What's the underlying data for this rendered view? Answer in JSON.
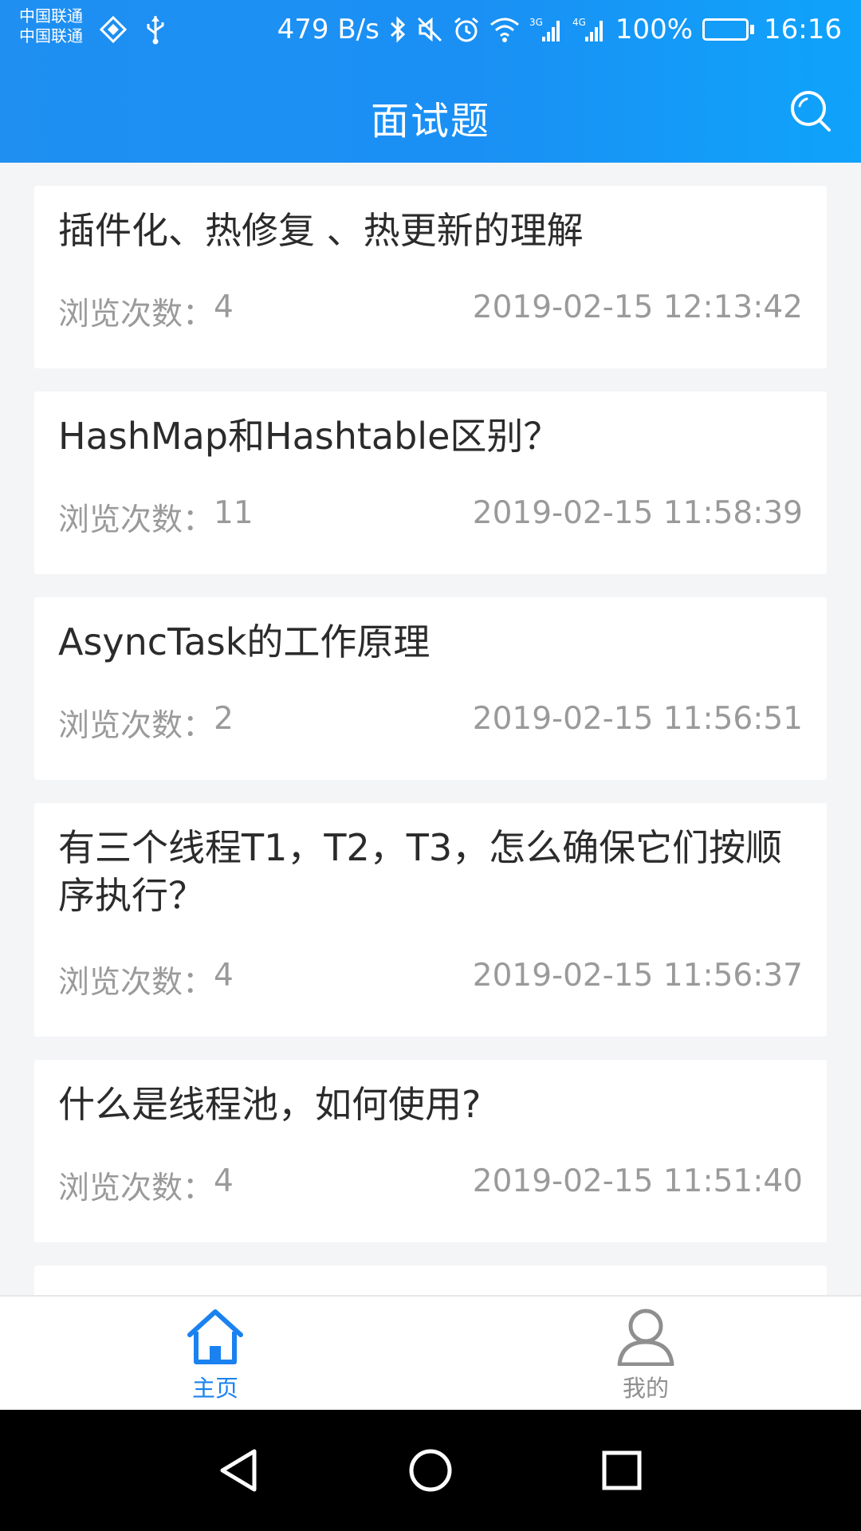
{
  "status_bar": {
    "carrier_1": "中国联通",
    "carrier_2": "中国联通",
    "net_speed": "479 B/s",
    "net_3g": "3G",
    "net_4g": "4G",
    "battery": "100%",
    "time": "16:16"
  },
  "header": {
    "title": "面试题",
    "search_icon": "search-icon"
  },
  "list": {
    "items": [
      {
        "title": "插件化、热修复 、热更新的理解",
        "views_label": "浏览次数：",
        "views": "4",
        "datetime": "2019-02-15 12:13:42"
      },
      {
        "title": "HashMap和Hashtable区别？",
        "views_label": "浏览次数：",
        "views": "11",
        "datetime": "2019-02-15 11:58:39"
      },
      {
        "title": "AsyncTask的工作原理",
        "views_label": "浏览次数：",
        "views": "2",
        "datetime": "2019-02-15 11:56:51"
      },
      {
        "title": "有三个线程T1，T2，T3，怎么确保它们按顺序执行？",
        "views_label": "浏览次数：",
        "views": "4",
        "datetime": "2019-02-15 11:56:37"
      },
      {
        "title": "什么是线程池，如何使用?",
        "views_label": "浏览次数：",
        "views": "4",
        "datetime": "2019-02-15 11:51:40"
      }
    ]
  },
  "tabbar": {
    "tabs": [
      {
        "label": "主页",
        "icon": "home-icon",
        "active": true,
        "color": "#1a82f0"
      },
      {
        "label": "我的",
        "icon": "user-icon",
        "active": false,
        "color": "#8f8f8f"
      }
    ]
  },
  "nav": {
    "back": "back-icon",
    "home": "home-circle-icon",
    "recents": "recents-icon"
  },
  "colors": {
    "header_start": "#1f8ff2",
    "header_end": "#0fa3fb",
    "accent": "#1a82f0"
  }
}
